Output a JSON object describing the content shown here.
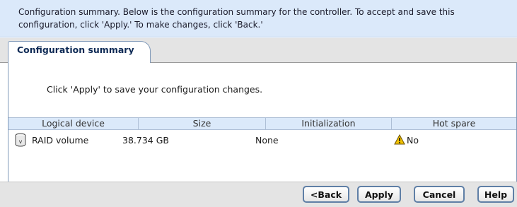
{
  "header": {
    "message": "Configuration summary. Below is the configuration summary for the controller. To accept and save this configuration, click 'Apply.' To make changes, click 'Back.'"
  },
  "tabs": [
    {
      "label": "Configuration summary",
      "selected": true
    }
  ],
  "content": {
    "instruction": "Click 'Apply' to save your configuration changes."
  },
  "table": {
    "columns": [
      "Logical device",
      "Size",
      "Initialization",
      "Hot spare"
    ],
    "rows": [
      {
        "icon": "disk-icon",
        "logical_device": "RAID volume",
        "size": "38.734 GB",
        "initialization": "None",
        "hot_spare_icon": "warning-icon",
        "hot_spare": "No"
      }
    ]
  },
  "footer": {
    "back_label": "<Back",
    "apply_label": "Apply",
    "cancel_label": "Cancel",
    "help_label": "Help"
  },
  "colors": {
    "header_bg": "#dbe9fa",
    "tab_text": "#0e2a55",
    "button_border": "#5f7fa6",
    "warning": "#f2c200"
  }
}
